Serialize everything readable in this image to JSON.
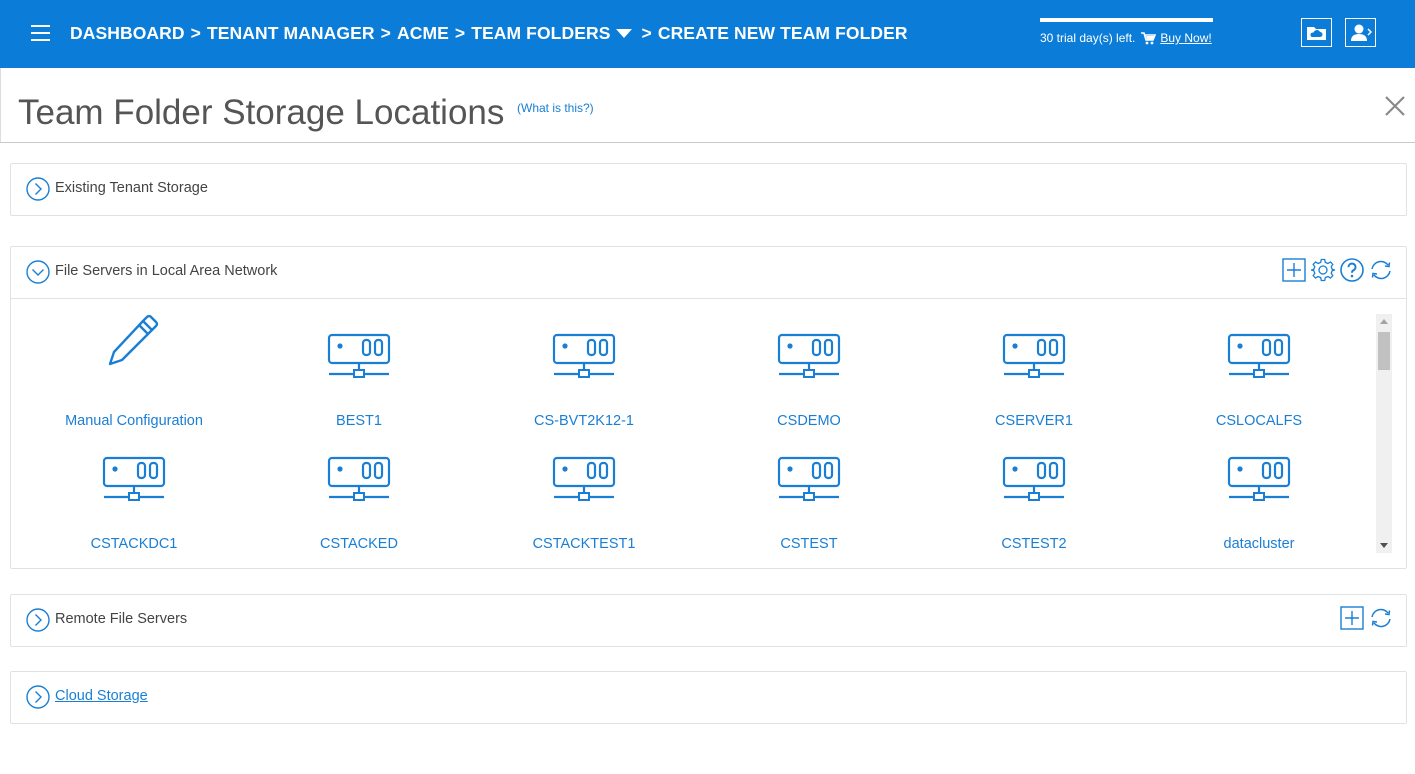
{
  "breadcrumb": {
    "items": [
      "DASHBOARD",
      "TENANT MANAGER",
      "ACME",
      "TEAM FOLDERS",
      "CREATE NEW TEAM FOLDER"
    ],
    "separator": ">"
  },
  "trial": {
    "text": "30 trial day(s) left.",
    "buy_label": "Buy Now!"
  },
  "page": {
    "title": "Team Folder Storage Locations",
    "help_link": "(What is this?)"
  },
  "panels": {
    "existing": {
      "title": "Existing Tenant Storage"
    },
    "lan": {
      "title": "File Servers in Local Area Network"
    },
    "remote": {
      "title": "Remote File Servers"
    },
    "cloud": {
      "title": "Cloud Storage"
    }
  },
  "servers": [
    {
      "label": "Manual Configuration",
      "icon": "pencil-icon"
    },
    {
      "label": "BEST1",
      "icon": "server-icon"
    },
    {
      "label": "CS-BVT2K12-1",
      "icon": "server-icon"
    },
    {
      "label": "CSDEMO",
      "icon": "server-icon"
    },
    {
      "label": "CSERVER1",
      "icon": "server-icon"
    },
    {
      "label": "CSLOCALFS",
      "icon": "server-icon"
    },
    {
      "label": "CSTACKDC1",
      "icon": "server-icon"
    },
    {
      "label": "CSTACKED",
      "icon": "server-icon"
    },
    {
      "label": "CSTACKTEST1",
      "icon": "server-icon"
    },
    {
      "label": "CSTEST",
      "icon": "server-icon"
    },
    {
      "label": "CSTEST2",
      "icon": "server-icon"
    },
    {
      "label": "datacluster",
      "icon": "server-icon"
    }
  ],
  "colors": {
    "topbar": "#0b7dd8",
    "accent": "#1a7fd4",
    "title_text": "#555555"
  }
}
